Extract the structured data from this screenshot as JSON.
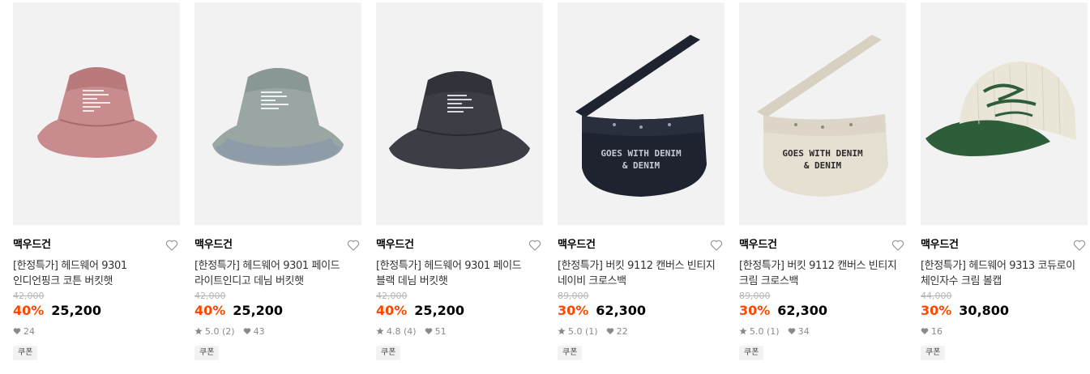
{
  "products": [
    {
      "brand": "맥우드건",
      "name_line1": "[한정특가] 헤드웨어 9301",
      "name_line2": "인디언핑크 코튼 버킷햇",
      "original_price": "42,000",
      "discount": "40%",
      "price": "25,200",
      "rating": "",
      "reviews": "",
      "likes": "24",
      "coupon": "쿠폰",
      "image": "bucket-hat-pink",
      "image_color": "#c98c8e"
    },
    {
      "brand": "맥우드건",
      "name_line1": "[한정특가] 헤드웨어 9301 페이드",
      "name_line2": "라이트인디고 데님 버킷햇",
      "original_price": "42,000",
      "discount": "40%",
      "price": "25,200",
      "rating": "5.0",
      "reviews": "(2)",
      "likes": "43",
      "coupon": "쿠폰",
      "image": "bucket-hat-light-indigo",
      "image_color": "#9aa6a3"
    },
    {
      "brand": "맥우드건",
      "name_line1": "[한정특가] 헤드웨어 9301 페이드",
      "name_line2": "블랙 데님 버킷햇",
      "original_price": "42,000",
      "discount": "40%",
      "price": "25,200",
      "rating": "4.8",
      "reviews": "(4)",
      "likes": "51",
      "coupon": "쿠폰",
      "image": "bucket-hat-black-denim",
      "image_color": "#3c3d45"
    },
    {
      "brand": "맥우드건",
      "name_line1": "[한정특가] 버킷 9112 캔버스 빈티지",
      "name_line2": "네이비 크로스백",
      "original_price": "89,000",
      "discount": "30%",
      "price": "62,300",
      "rating": "5.0",
      "reviews": "(1)",
      "likes": "22",
      "coupon": "쿠폰",
      "image": "crossbag-navy",
      "image_color": "#1f2330",
      "bag_text": "GOES WITH DENIM & DENIM"
    },
    {
      "brand": "맥우드건",
      "name_line1": "[한정특가] 버킷 9112 캔버스 빈티지",
      "name_line2": "크림 크로스백",
      "original_price": "89,000",
      "discount": "30%",
      "price": "62,300",
      "rating": "5.0",
      "reviews": "(1)",
      "likes": "34",
      "coupon": "쿠폰",
      "image": "crossbag-cream",
      "image_color": "#e6e0d3",
      "bag_text": "GOES WITH DENIM & DENIM"
    },
    {
      "brand": "맥우드건",
      "name_line1": "[한정특가] 헤드웨어 9313 코듀로이",
      "name_line2": "체인자수 크림 볼캡",
      "original_price": "44,000",
      "discount": "30%",
      "price": "30,800",
      "rating": "",
      "reviews": "",
      "likes": "16",
      "coupon": "쿠폰",
      "image": "ballcap-cream-green",
      "image_color": "#e9e6d8"
    }
  ],
  "colors": {
    "discount": "#ff4800",
    "strike": "#b5b5b5",
    "thumb_bg": "#f2f2f2"
  }
}
